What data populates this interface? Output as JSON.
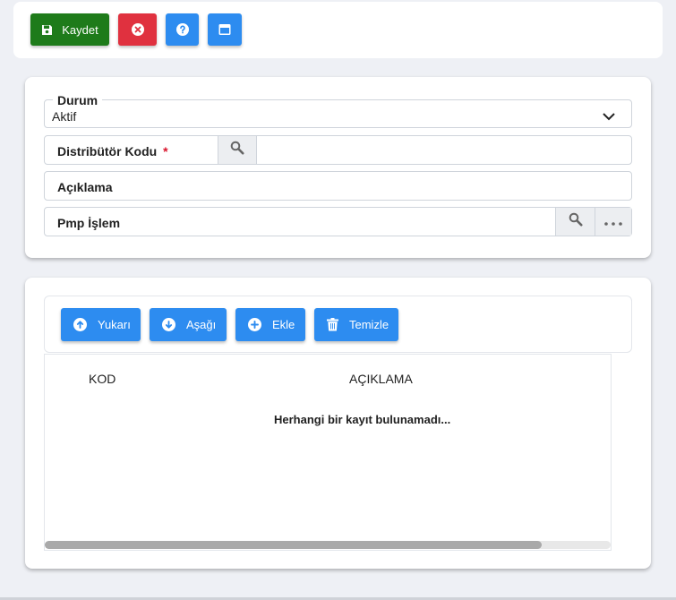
{
  "toolbar": {
    "save_label": "Kaydet"
  },
  "form": {
    "status": {
      "label": "Durum",
      "value": "Aktif"
    },
    "distributor": {
      "label": "Distribütör Kodu",
      "required_mark": "*"
    },
    "description": {
      "label": "Açıklama"
    },
    "pmp": {
      "label": "Pmp İşlem"
    }
  },
  "grid": {
    "buttons": {
      "up": "Yukarı",
      "down": "Aşağı",
      "add": "Ekle",
      "clear": "Temizle"
    },
    "columns": [
      "KOD",
      "AÇIKLAMA"
    ],
    "empty_text": "Herhangi bir kayıt bulunamadı...",
    "rows": []
  },
  "colors": {
    "save": "#1e7b1a",
    "cancel": "#e0313f",
    "primary": "#2d8cf0"
  }
}
